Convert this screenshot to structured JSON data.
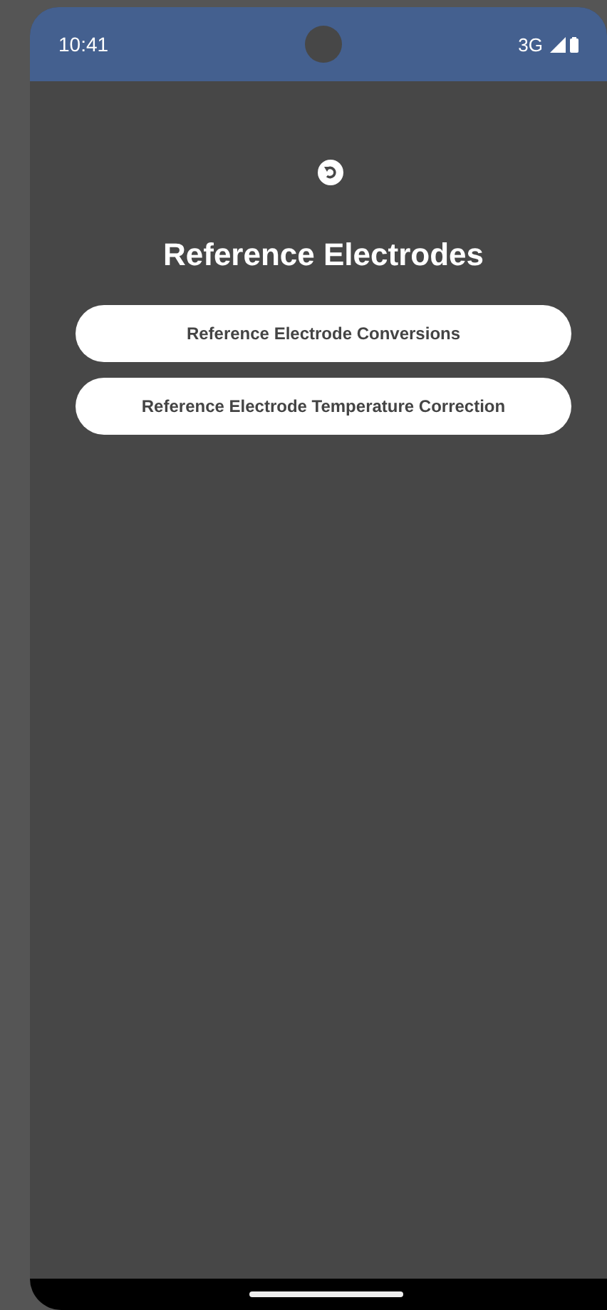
{
  "status_bar": {
    "time": "10:41",
    "network": "3G"
  },
  "title": "Reference Electrodes",
  "buttons": [
    "Reference Electrode Conversions",
    "Reference Electrode Temperature Correction"
  ]
}
